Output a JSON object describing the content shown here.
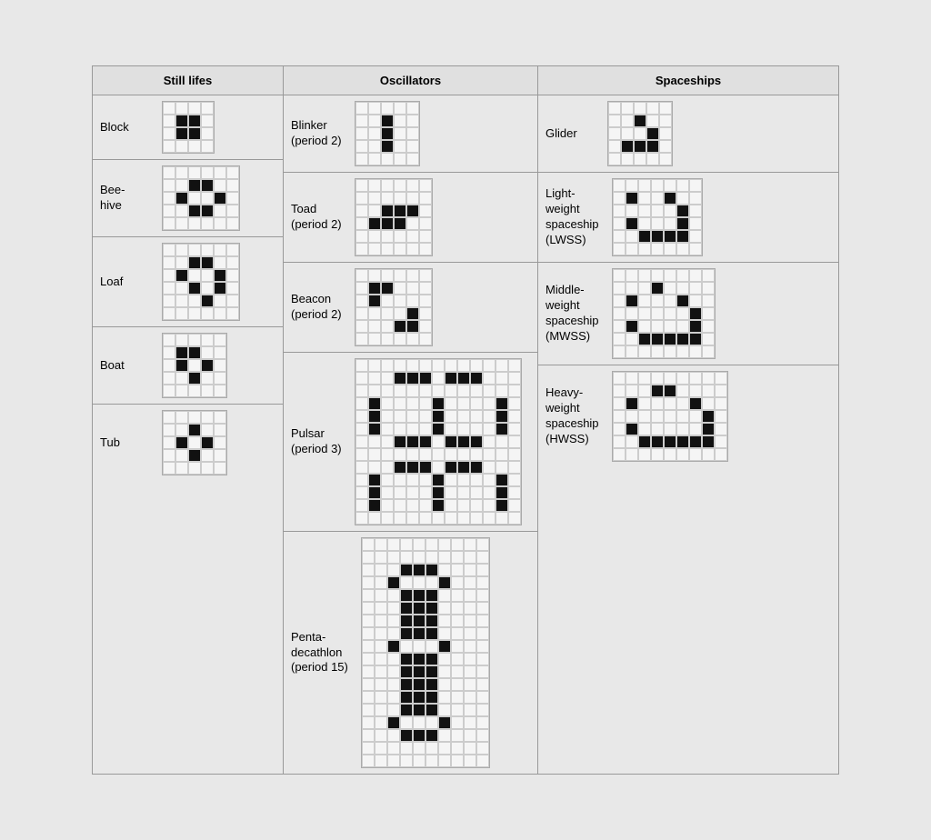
{
  "sections": {
    "still_lifes": {
      "header": "Still lifes",
      "patterns": [
        {
          "name": "Block",
          "cols": 4,
          "rows": 4,
          "cells": [
            0,
            0,
            0,
            0,
            0,
            1,
            1,
            0,
            0,
            1,
            1,
            0,
            0,
            0,
            0,
            0
          ]
        },
        {
          "name": "Bee-\nhive",
          "cols": 6,
          "rows": 5,
          "cells": [
            0,
            0,
            0,
            0,
            0,
            0,
            0,
            0,
            1,
            1,
            0,
            0,
            0,
            1,
            0,
            0,
            1,
            0,
            0,
            0,
            1,
            1,
            0,
            0,
            0,
            0,
            0,
            0,
            0,
            0
          ]
        },
        {
          "name": "Loaf",
          "cols": 6,
          "rows": 6,
          "cells": [
            0,
            0,
            0,
            0,
            0,
            0,
            0,
            0,
            1,
            1,
            0,
            0,
            0,
            1,
            0,
            0,
            1,
            0,
            0,
            0,
            1,
            0,
            1,
            0,
            0,
            0,
            0,
            1,
            0,
            0,
            0,
            0,
            0,
            0,
            0,
            0
          ]
        },
        {
          "name": "Boat",
          "cols": 5,
          "rows": 5,
          "cells": [
            0,
            0,
            0,
            0,
            0,
            0,
            1,
            1,
            0,
            0,
            0,
            1,
            0,
            1,
            0,
            0,
            0,
            1,
            0,
            0,
            0,
            0,
            0,
            0,
            0
          ]
        },
        {
          "name": "Tub",
          "cols": 5,
          "rows": 5,
          "cells": [
            0,
            0,
            0,
            0,
            0,
            0,
            0,
            1,
            0,
            0,
            0,
            1,
            0,
            1,
            0,
            0,
            0,
            1,
            0,
            0,
            0,
            0,
            0,
            0,
            0
          ]
        }
      ]
    },
    "oscillators": {
      "header": "Oscillators",
      "patterns": [
        {
          "name": "Blinker\n(period 2)",
          "cols": 5,
          "rows": 5,
          "cells": [
            0,
            0,
            0,
            0,
            0,
            0,
            0,
            1,
            0,
            0,
            0,
            0,
            1,
            0,
            0,
            0,
            0,
            1,
            0,
            0,
            0,
            0,
            0,
            0,
            0
          ]
        },
        {
          "name": "Toad\n(period 2)",
          "cols": 6,
          "rows": 6,
          "cells": [
            0,
            0,
            0,
            0,
            0,
            0,
            0,
            0,
            0,
            0,
            0,
            0,
            0,
            0,
            1,
            1,
            1,
            0,
            0,
            1,
            1,
            1,
            0,
            0,
            0,
            0,
            0,
            0,
            0,
            0,
            0,
            0,
            0,
            0,
            0,
            0
          ]
        },
        {
          "name": "Beacon\n(period 2)",
          "cols": 6,
          "rows": 6,
          "cells": [
            0,
            0,
            0,
            0,
            0,
            0,
            0,
            1,
            1,
            0,
            0,
            0,
            0,
            1,
            0,
            0,
            0,
            0,
            0,
            0,
            0,
            0,
            1,
            0,
            0,
            0,
            0,
            1,
            1,
            0,
            0,
            0,
            0,
            0,
            0,
            0
          ]
        },
        {
          "name": "Pulsar\n(period 3)",
          "cols": 13,
          "rows": 13,
          "cells": [
            0,
            0,
            0,
            0,
            0,
            0,
            0,
            0,
            0,
            0,
            0,
            0,
            0,
            0,
            0,
            0,
            1,
            1,
            1,
            0,
            1,
            1,
            1,
            0,
            0,
            0,
            0,
            0,
            0,
            0,
            0,
            0,
            0,
            0,
            0,
            0,
            0,
            0,
            0,
            0,
            1,
            0,
            0,
            0,
            0,
            1,
            0,
            0,
            0,
            0,
            1,
            0,
            0,
            1,
            0,
            0,
            0,
            0,
            1,
            0,
            0,
            0,
            0,
            1,
            0,
            0,
            1,
            0,
            0,
            0,
            0,
            1,
            0,
            0,
            0,
            0,
            1,
            0,
            0,
            0,
            0,
            1,
            1,
            1,
            0,
            1,
            1,
            1,
            0,
            0,
            0,
            0,
            0,
            0,
            0,
            0,
            0,
            0,
            0,
            0,
            0,
            0,
            0,
            0,
            0,
            0,
            0,
            1,
            1,
            1,
            0,
            1,
            1,
            1,
            0,
            0,
            0,
            0,
            1,
            0,
            0,
            0,
            0,
            1,
            0,
            0,
            0,
            0,
            1,
            0,
            0,
            1,
            0,
            0,
            0,
            0,
            1,
            0,
            0,
            0,
            0,
            1,
            0,
            0,
            1,
            0,
            0,
            0,
            0,
            1,
            0,
            0,
            0,
            0,
            1,
            0,
            0,
            0,
            0,
            0,
            0,
            0,
            0,
            0,
            0,
            0,
            0,
            0,
            0
          ]
        },
        {
          "name": "Penta-\ndecathlon\n(period 15)",
          "cols": 10,
          "rows": 18,
          "cells": [
            0,
            0,
            0,
            0,
            0,
            0,
            0,
            0,
            0,
            0,
            0,
            0,
            0,
            0,
            0,
            0,
            0,
            0,
            0,
            0,
            0,
            0,
            0,
            1,
            1,
            1,
            0,
            0,
            0,
            0,
            0,
            0,
            1,
            0,
            0,
            0,
            1,
            0,
            0,
            0,
            0,
            0,
            0,
            1,
            1,
            1,
            0,
            0,
            0,
            0,
            0,
            0,
            0,
            1,
            1,
            1,
            0,
            0,
            0,
            0,
            0,
            0,
            0,
            1,
            1,
            1,
            0,
            0,
            0,
            0,
            0,
            0,
            0,
            1,
            1,
            1,
            0,
            0,
            0,
            0,
            0,
            0,
            1,
            0,
            0,
            0,
            1,
            0,
            0,
            0,
            0,
            0,
            0,
            1,
            1,
            1,
            0,
            0,
            0,
            0,
            0,
            0,
            0,
            1,
            1,
            1,
            0,
            0,
            0,
            0,
            0,
            0,
            0,
            1,
            1,
            1,
            0,
            0,
            0,
            0,
            0,
            0,
            0,
            1,
            1,
            1,
            0,
            0,
            0,
            0,
            0,
            0,
            0,
            1,
            1,
            1,
            0,
            0,
            0,
            0,
            0,
            0,
            1,
            0,
            0,
            0,
            1,
            0,
            0,
            0,
            0,
            0,
            0,
            1,
            1,
            1,
            0,
            0,
            0,
            0,
            0,
            0,
            0,
            0,
            0,
            0,
            0,
            0,
            0,
            0,
            0,
            0,
            0,
            0,
            0,
            0,
            0,
            0,
            0,
            0
          ]
        }
      ]
    },
    "spaceships": {
      "header": "Spaceships",
      "patterns": [
        {
          "name": "Glider",
          "cols": 5,
          "rows": 5,
          "cells": [
            0,
            0,
            0,
            0,
            0,
            0,
            0,
            1,
            0,
            0,
            0,
            0,
            0,
            1,
            0,
            0,
            1,
            1,
            1,
            0,
            0,
            0,
            0,
            0,
            0
          ]
        },
        {
          "name": "Light-\nweight\nspaceship\n(LWSS)",
          "cols": 7,
          "rows": 6,
          "cells": [
            0,
            0,
            0,
            0,
            0,
            0,
            0,
            0,
            1,
            0,
            0,
            1,
            0,
            0,
            0,
            0,
            0,
            0,
            0,
            1,
            0,
            0,
            1,
            0,
            0,
            0,
            1,
            0,
            0,
            0,
            1,
            1,
            1,
            1,
            0,
            0,
            0,
            0,
            0,
            0,
            0,
            0
          ]
        },
        {
          "name": "Middle-\nweight\nspaceship\n(MWSS)",
          "cols": 8,
          "rows": 7,
          "cells": [
            0,
            0,
            0,
            0,
            0,
            0,
            0,
            0,
            0,
            0,
            0,
            1,
            0,
            0,
            0,
            0,
            0,
            1,
            0,
            0,
            0,
            1,
            0,
            0,
            0,
            0,
            0,
            0,
            0,
            0,
            1,
            0,
            0,
            1,
            0,
            0,
            0,
            0,
            1,
            0,
            0,
            0,
            1,
            1,
            1,
            1,
            1,
            0,
            0,
            0,
            0,
            0,
            0,
            0,
            0,
            0
          ]
        },
        {
          "name": "Heavy-\nweight\nspaceship\n(HWSS)",
          "cols": 9,
          "rows": 7,
          "cells": [
            0,
            0,
            0,
            0,
            0,
            0,
            0,
            0,
            0,
            0,
            0,
            0,
            1,
            1,
            0,
            0,
            0,
            0,
            0,
            1,
            0,
            0,
            0,
            0,
            1,
            0,
            0,
            0,
            0,
            0,
            0,
            0,
            0,
            0,
            1,
            0,
            0,
            1,
            0,
            0,
            0,
            0,
            0,
            1,
            0,
            0,
            0,
            1,
            1,
            1,
            1,
            1,
            1,
            0,
            0,
            0,
            0,
            0,
            0,
            0,
            0,
            0,
            0
          ]
        }
      ]
    }
  }
}
